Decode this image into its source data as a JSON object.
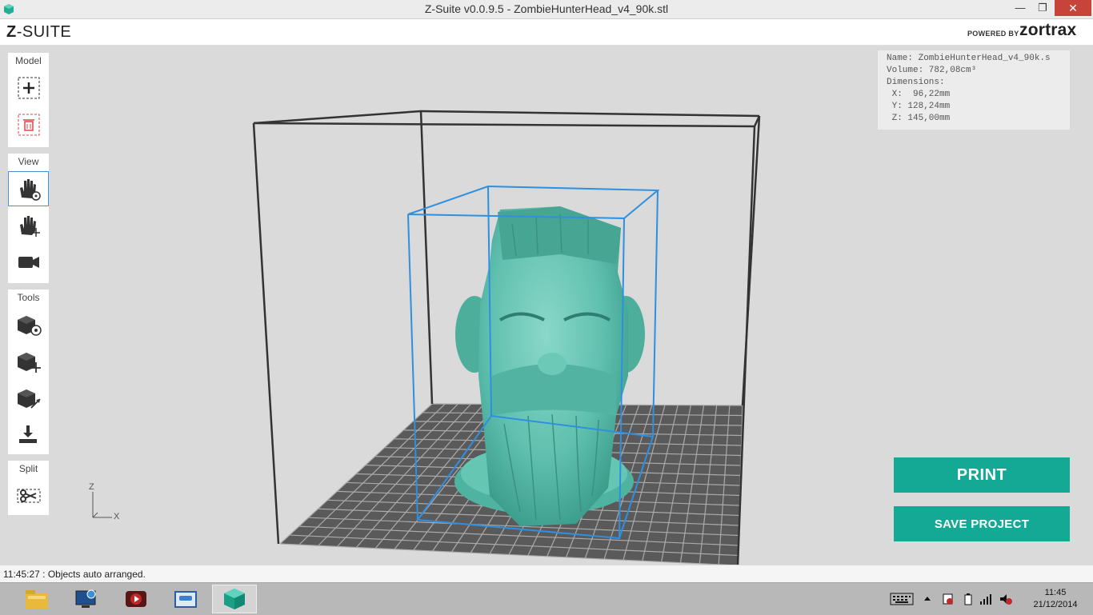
{
  "window": {
    "title": "Z-Suite v0.0.9.5 - ZombieHunterHead_v4_90k.stl",
    "minimize_label": "—",
    "maximize_label": "❐",
    "close_label": "✕"
  },
  "header": {
    "logo_bold": "Z",
    "logo_rest": "-SUITE",
    "powered_by": "POWERED BY",
    "brand": "zortrax"
  },
  "toolbar": {
    "model_title": "Model",
    "view_title": "View",
    "tools_title": "Tools",
    "split_title": "Split"
  },
  "model_info": {
    "name_line": "Name: ZombieHunterHead_v4_90k.s",
    "volume_line": "Volume: 782,08cm³",
    "dimensions_label": "Dimensions:",
    "x_line": " X:  96,22mm",
    "y_line": " Y: 128,24mm",
    "z_line": " Z: 145,00mm"
  },
  "axes": {
    "z_label": "Z",
    "x_label": "X"
  },
  "actions": {
    "print_label": "PRINT",
    "save_label": "SAVE PROJECT"
  },
  "status": {
    "message": "11:45:27 : Objects auto arranged."
  },
  "taskbar": {
    "time": "11:45",
    "date": "21/12/2014"
  },
  "colors": {
    "accent": "#14a995",
    "model": "#5fbfae",
    "bounding_box": "#2f8fe0",
    "close": "#c7443b"
  }
}
